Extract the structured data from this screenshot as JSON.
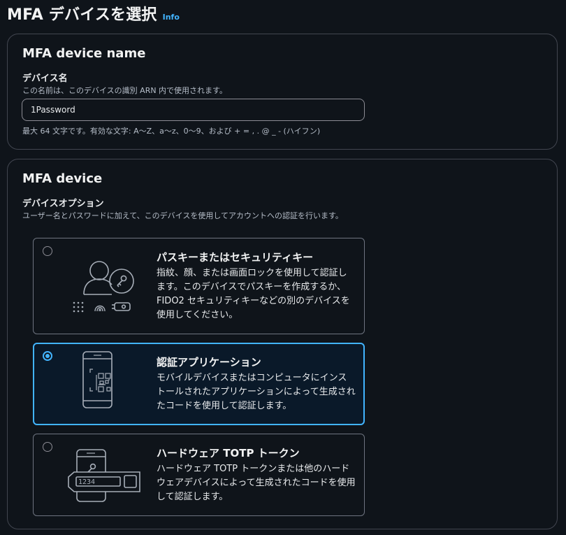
{
  "page": {
    "title": "MFA デバイスを選択",
    "info_link": "Info"
  },
  "name_section": {
    "title": "MFA device name",
    "field_label": "デバイス名",
    "field_description": "この名前は、このデバイスの識別 ARN 内で使用されます。",
    "input_value": "1Password",
    "constraint_text": "最大 64 文字です。有効な文字: A〜Z、a〜z、0〜9、および + = , . @ _ - (ハイフン)"
  },
  "device_section": {
    "title": "MFA device",
    "field_label": "デバイスオプション",
    "field_description": "ユーザー名とパスワードに加えて、このデバイスを使用してアカウントへの認証を行います。",
    "options": [
      {
        "title": "パスキーまたはセキュリティキー",
        "description": "指紋、顔、または画面ロックを使用して認証します。このデバイスでパスキーを作成するか、FIDO2 セキュリティキーなどの別のデバイスを使用してください。",
        "selected": false,
        "icon": "passkey-icon"
      },
      {
        "title": "認証アプリケーション",
        "description": "モバイルデバイスまたはコンピュータにインストールされたアプリケーションによって生成されたコードを使用して認証します。",
        "selected": true,
        "icon": "authenticator-app-icon"
      },
      {
        "title": "ハードウェア TOTP トークン",
        "description": "ハードウェア TOTP トークンまたは他のハードウェアデバイスによって生成されたコードを使用して認証します。",
        "selected": false,
        "icon": "hardware-token-icon",
        "token_display": "1234"
      }
    ]
  },
  "colors": {
    "background": "#0f141a",
    "accent": "#42b4ff",
    "border": "#424650",
    "text": "#e9ebed"
  }
}
